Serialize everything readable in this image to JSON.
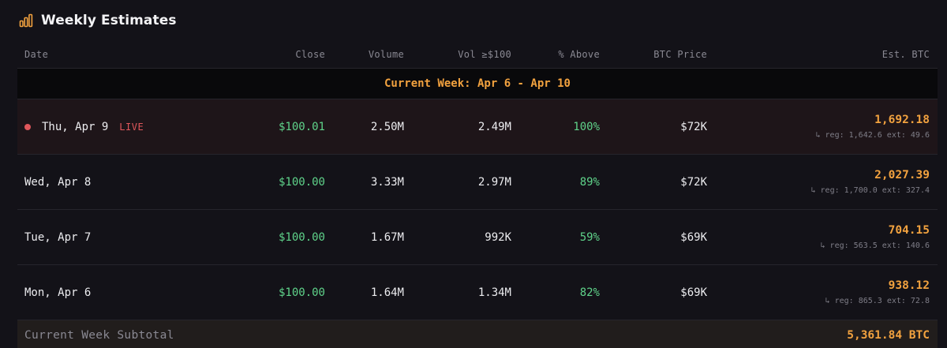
{
  "header": {
    "title": "Weekly Estimates",
    "icon": "bar-chart-icon",
    "accent": "#f2a23f"
  },
  "columns": [
    "Date",
    "Close",
    "Volume",
    "Vol ≥$100",
    "% Above",
    "BTC Price",
    "Est. BTC"
  ],
  "week_banner": "Current Week: Apr 6 - Apr 10",
  "rows": [
    {
      "date": "Thu, Apr 9",
      "live": "LIVE",
      "close": "$100.01",
      "volume": "2.50M",
      "vol100": "2.49M",
      "above": "100%",
      "btc_price": "$72K",
      "est_btc": "1,692.18",
      "est_detail": "↳ reg: 1,642.6 ext: 49.6"
    },
    {
      "date": "Wed, Apr 8",
      "close": "$100.00",
      "volume": "3.33M",
      "vol100": "2.97M",
      "above": "89%",
      "btc_price": "$72K",
      "est_btc": "2,027.39",
      "est_detail": "↳ reg: 1,700.0 ext: 327.4"
    },
    {
      "date": "Tue, Apr 7",
      "close": "$100.00",
      "volume": "1.67M",
      "vol100": "992K",
      "above": "59%",
      "btc_price": "$69K",
      "est_btc": "704.15",
      "est_detail": "↳ reg: 563.5 ext: 140.6"
    },
    {
      "date": "Mon, Apr 6",
      "close": "$100.00",
      "volume": "1.64M",
      "vol100": "1.34M",
      "above": "82%",
      "btc_price": "$69K",
      "est_btc": "938.12",
      "est_detail": "↳ reg: 865.3 ext: 72.8"
    }
  ],
  "subtotal": {
    "label": "Current Week Subtotal",
    "value": "5,361.84 BTC"
  },
  "colors": {
    "positive": "#5fd38a",
    "live": "#e0575b",
    "estimate": "#f2a23f"
  }
}
